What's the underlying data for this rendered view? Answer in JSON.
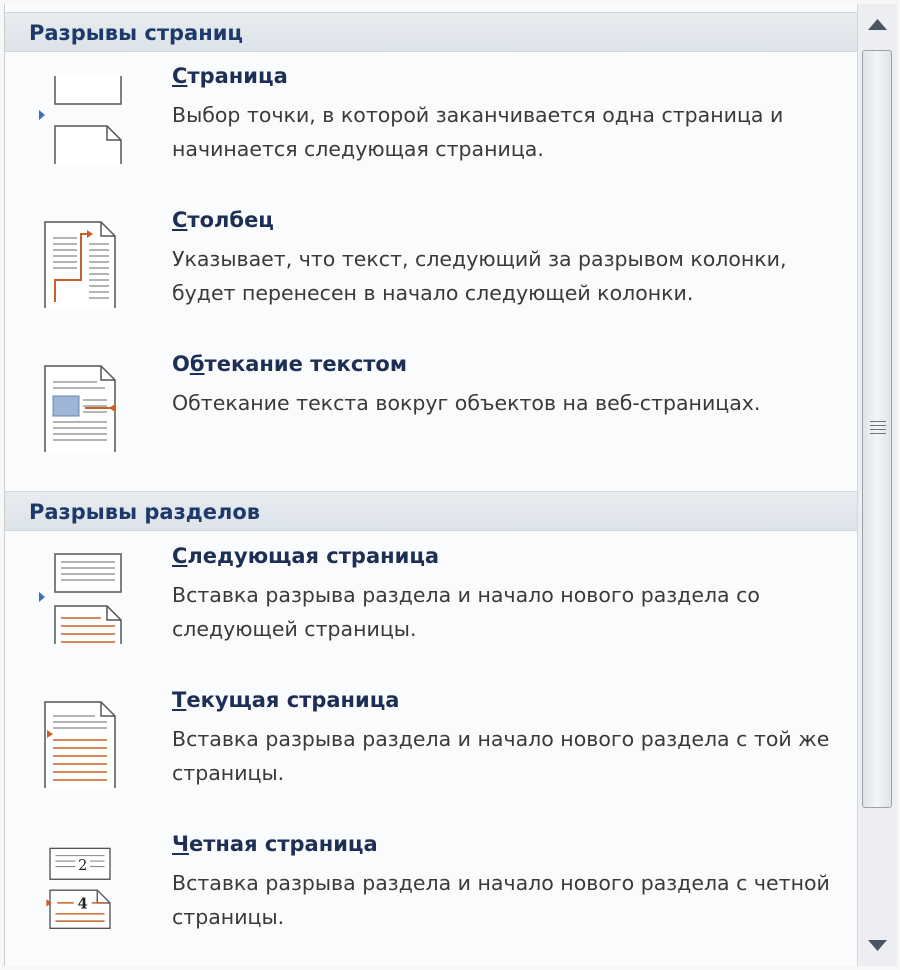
{
  "sections": {
    "page_breaks": {
      "title": "Разрывы страниц",
      "items": [
        {
          "title_prefix": "",
          "title_key": "С",
          "title_rest": "траница",
          "description": "Выбор точки, в которой заканчивается одна страница и начинается следующая страница.",
          "icon": "page-break-icon"
        },
        {
          "title_prefix": "",
          "title_key": "С",
          "title_rest": "толбец",
          "description": "Указывает, что текст, следующий за разрывом колонки, будет перенесен в начало следующей колонки.",
          "icon": "column-break-icon"
        },
        {
          "title_prefix": "О",
          "title_key": "б",
          "title_rest": "текание текстом",
          "description": "Обтекание текста вокруг объектов на веб-страницах.",
          "icon": "text-wrapping-icon"
        }
      ]
    },
    "section_breaks": {
      "title": "Разрывы разделов",
      "items": [
        {
          "title_prefix": "",
          "title_key": "С",
          "title_rest": "ледующая страница",
          "description": "Вставка разрыва раздела и начало нового раздела со следующей страницы.",
          "icon": "next-page-icon"
        },
        {
          "title_prefix": "",
          "title_key": "Т",
          "title_rest": "екущая страница",
          "description": "Вставка разрыва раздела и начало нового раздела с той же страницы.",
          "icon": "continuous-icon"
        },
        {
          "title_prefix": "",
          "title_key": "Ч",
          "title_rest": "етная страница",
          "description": "Вставка разрыва раздела и начало нового раздела с четной страницы.",
          "icon": "even-page-icon"
        }
      ]
    }
  },
  "icon_labels": {
    "even_top": "2",
    "even_bottom": "4"
  },
  "scrollbar": {
    "up_icon": "arrow-up-icon",
    "down_icon": "arrow-down-icon"
  },
  "colors": {
    "header_text": "#1e3a6b",
    "accent_orange": "#c9602a",
    "arrow_blue": "#3a6fc0"
  }
}
